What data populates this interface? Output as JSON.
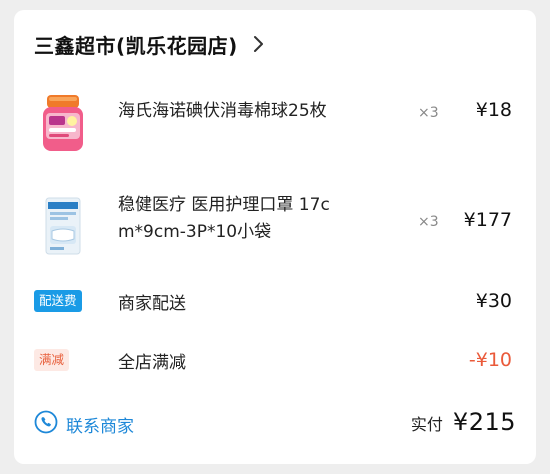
{
  "store": {
    "name": "三鑫超市(凯乐花园店)",
    "chevron_icon": "chevron-right-icon"
  },
  "items": [
    {
      "name_line1": "海氏海诺碘伏消毒棉球25枚",
      "name_line2": "",
      "qty": "×3",
      "price": "¥18",
      "thumb_icon": "iodine-cotton-bottle-icon"
    },
    {
      "name_line1": "稳健医疗 医用护理口罩 17c",
      "name_line2": "m*9cm-3P*10小袋",
      "qty": "×3",
      "price": "¥177",
      "thumb_icon": "mask-pack-icon"
    }
  ],
  "delivery": {
    "tag": "配送费",
    "label": "商家配送",
    "value": "¥30"
  },
  "discount": {
    "tag": "满减",
    "label": "全店满减",
    "value": "-¥10"
  },
  "contact": {
    "label": "联系商家",
    "icon": "phone-icon"
  },
  "paid": {
    "label": "实付",
    "value": "¥215"
  },
  "colors": {
    "accent_blue": "#1a9be6",
    "discount_red": "#ea5a3a",
    "link_blue": "#1e88d8"
  }
}
